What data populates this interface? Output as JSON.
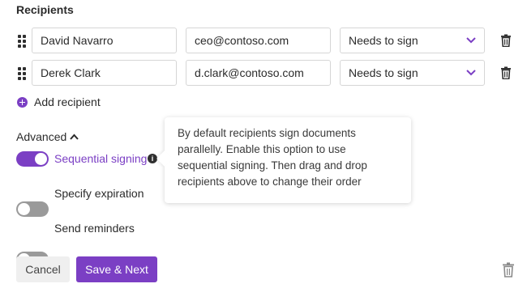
{
  "section": {
    "title": "Recipients"
  },
  "recipients": [
    {
      "name": "David Navarro",
      "email": "ceo@contoso.com",
      "role": "Needs to sign"
    },
    {
      "name": "Derek Clark",
      "email": "d.clark@contoso.com",
      "role": "Needs to sign"
    }
  ],
  "add_recipient_label": "Add recipient",
  "advanced": {
    "label": "Advanced",
    "toggles": [
      {
        "label": "Sequential signing",
        "on": true
      },
      {
        "label": "Specify expiration",
        "on": false
      },
      {
        "label": "Send reminders",
        "on": false
      }
    ],
    "info_icon": "i"
  },
  "tooltip": {
    "text": "By default recipients sign documents parallelly. Enable this option to use sequential signing. Then drag and drop recipients above to change their order"
  },
  "footer": {
    "cancel_label": "Cancel",
    "save_label": "Save & Next"
  },
  "colors": {
    "accent": "#7b3fc4",
    "toggle_off": "#9a9a9a"
  }
}
